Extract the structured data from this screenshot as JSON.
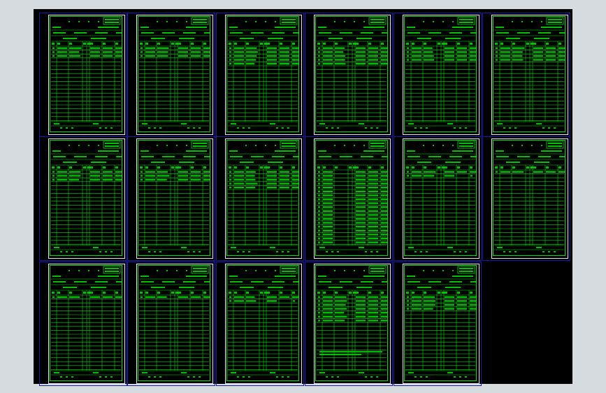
{
  "viewer": {
    "background": "#d6dbe0",
    "canvas_color": "#000000",
    "sheet_border_color": "#1a1aa8",
    "paper_border_color": "#e6e6e6",
    "drawing_color": "#00e000",
    "fill_color": "#00c000"
  },
  "sheets": [
    {
      "id": "r1c1",
      "variant": "process-card"
    },
    {
      "id": "r1c2",
      "variant": "process-card"
    },
    {
      "id": "r1c3",
      "variant": "process-card"
    },
    {
      "id": "r1c4",
      "variant": "process-card"
    },
    {
      "id": "r1c5",
      "variant": "process-card"
    },
    {
      "id": "r1c6",
      "variant": "process-card"
    },
    {
      "id": "r2c1",
      "variant": "process-card"
    },
    {
      "id": "r2c2",
      "variant": "process-card"
    },
    {
      "id": "r2c3",
      "variant": "process-card"
    },
    {
      "id": "r2c4",
      "variant": "long-list"
    },
    {
      "id": "r2c5",
      "variant": "sparse"
    },
    {
      "id": "r2c6",
      "variant": "sparse"
    },
    {
      "id": "r3c1",
      "variant": "sparse"
    },
    {
      "id": "r3c2",
      "variant": "sparse"
    },
    {
      "id": "r3c3",
      "variant": "sparse"
    },
    {
      "id": "r3c4",
      "variant": "notes"
    },
    {
      "id": "r3c5",
      "variant": "process-card"
    }
  ]
}
